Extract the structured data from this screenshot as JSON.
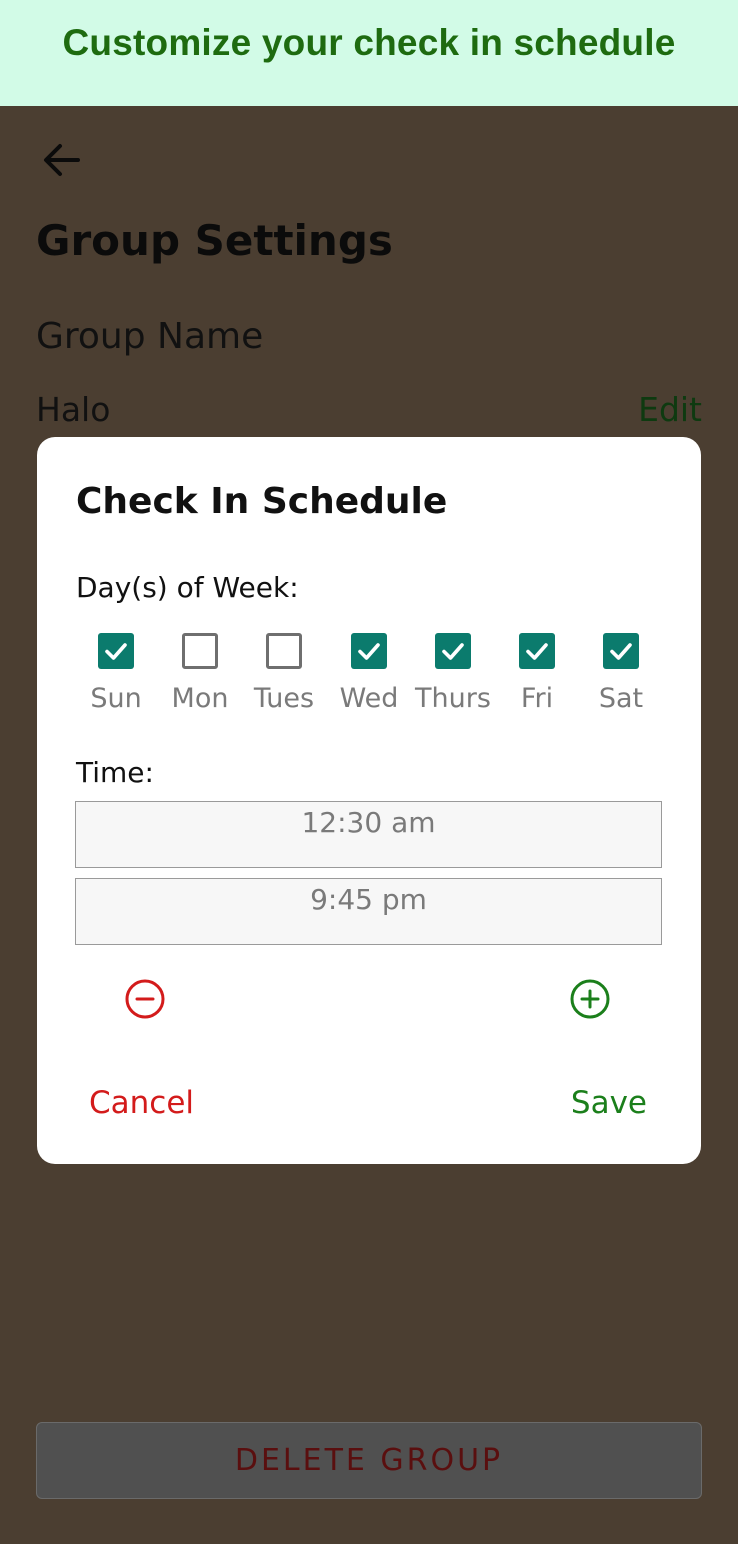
{
  "banner": {
    "text": "Customize your check in schedule"
  },
  "header": {
    "back_icon": "arrow-left-icon",
    "title": "Group Settings"
  },
  "group": {
    "section_label": "Group Name",
    "name_value": "Halo",
    "edit_label": "Edit"
  },
  "footer": {
    "delete_label": "DELETE GROUP"
  },
  "dialog": {
    "title": "Check In Schedule",
    "days_label": "Day(s) of Week:",
    "days": [
      {
        "label": "Sun",
        "checked": true
      },
      {
        "label": "Mon",
        "checked": false
      },
      {
        "label": "Tues",
        "checked": false
      },
      {
        "label": "Wed",
        "checked": true
      },
      {
        "label": "Thurs",
        "checked": true
      },
      {
        "label": "Fri",
        "checked": true
      },
      {
        "label": "Sat",
        "checked": true
      }
    ],
    "time_label": "Time:",
    "times": [
      "12:30 am",
      "9:45 pm"
    ],
    "remove_icon": "minus-circle-icon",
    "add_icon": "plus-circle-icon",
    "cancel_label": "Cancel",
    "save_label": "Save"
  },
  "colors": {
    "overlay_bg": "#4b3e31",
    "banner_bg": "#d2fbe7",
    "banner_text": "#1e6b10",
    "checkbox_checked": "#0b7b6d",
    "cancel": "#d31b1b",
    "save": "#1b7f1b"
  }
}
